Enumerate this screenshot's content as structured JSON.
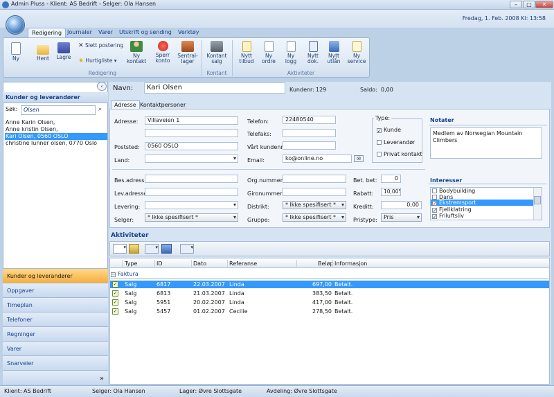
{
  "window": {
    "title": "Admin Pluss  -  Klient: AS Bedrift  -  Selger: Ola Hansen",
    "min": "–",
    "max": "□",
    "close": "✕"
  },
  "datebar": "Fredag, 1. Feb. 2008   Kl: 13:58",
  "tabs": [
    "Redigering",
    "Journaler",
    "Varer",
    "Utskrift og sending",
    "Verktøy"
  ],
  "ribbon": {
    "groups": {
      "redigering": "Redigering",
      "kontant": "Kontant",
      "aktiviteter": "Aktiviteter"
    },
    "buttons": {
      "ny": "Ny",
      "hent": "Hent",
      "lagre": "Lagre",
      "slett": "Slett postering",
      "hurtigliste": "Hurtigliste",
      "ny_kontakt_1": "Ny",
      "ny_kontakt_2": "kontakt",
      "sperr_1": "Sperr",
      "sperr_2": "konto",
      "sentral_1": "Sentral-",
      "sentral_2": "lager",
      "kontant_1": "Kontant",
      "kontant_2": "salg",
      "tilbud_1": "Nytt",
      "tilbud_2": "tilbud",
      "ordre_1": "Ny",
      "ordre_2": "ordre",
      "logg_1": "Ny",
      "logg_2": "logg",
      "dok_1": "Nytt",
      "dok_2": "dok.",
      "utlan_1": "Nytt",
      "utlan_2": "utlån",
      "service_1": "Ny",
      "service_2": "service"
    }
  },
  "left": {
    "title": "Kunder og leverandører",
    "search_label": "Søk:",
    "search_value": "Olsen",
    "items": [
      "Anne Karin Olsen,",
      "Anne kristin Olsen,",
      "Kari Olsen, 0560 OSLO",
      "christine lunner olsen, 0770 Oslo"
    ],
    "nav": [
      "Kunder og leverandører",
      "Oppgaver",
      "Timeplan",
      "Telefoner",
      "Regninger",
      "Varer",
      "Snarveier"
    ],
    "more": "»"
  },
  "header": {
    "name_label": "Navn:",
    "name_value": "Kari Olsen",
    "kundenr_label": "Kundenr:",
    "kundenr_value": "129",
    "saldo_label": "Saldo:",
    "saldo_value": "0,00"
  },
  "subtabs": [
    "Adresse",
    "Kontaktpersoner"
  ],
  "form": {
    "adresse_label": "Adresse:",
    "adresse_value": "Villaveien 1",
    "poststed_label": "Poststed:",
    "poststed_value": "0560 OSLO",
    "land_label": "Land:",
    "telefon_label": "Telefon:",
    "telefon_value": "22480540",
    "telefaks_label": "Telefaks:",
    "vart_label": "Vårt kundenr:",
    "email_label": "Email:",
    "email_value": "ko@online.no",
    "bes_label": "Bes.adresse:",
    "lev_label": "Lev.adresse:",
    "levering_label": "Levering:",
    "selger_label": "Selger:",
    "selger_value": "* Ikke spesifisert *",
    "org_label": "Org.nummer:",
    "giro_label": "Gironummer:",
    "distrikt_label": "Distrikt:",
    "distrikt_value": "* Ikke spesifisert *",
    "gruppe_label": "Gruppe:",
    "gruppe_value": "* Ikke spesifisert *",
    "betbet_label": "Bet. bet:",
    "betbet_value": "0",
    "rabatt_label": "Rabatt:",
    "rabatt_value": "10,00%",
    "kreditt_label": "Kreditt:",
    "kreditt_value": "0,00",
    "pristype_label": "Pristype:",
    "pristype_value": "Pris"
  },
  "type": {
    "title": "Type:",
    "kunde": "Kunde",
    "leverandor": "Leverandør",
    "privat": "Privat kontakt",
    "check": "✓"
  },
  "notater": {
    "title": "Notater",
    "text": "Medlem av Norwegian Mountain Climbers"
  },
  "interesser": {
    "title": "Interesser",
    "items": [
      "Bodybuilding",
      "Dans",
      "Ekstremsport",
      "Fjellklatring",
      "Friluftsliv"
    ]
  },
  "aktiviteter": {
    "title": "Aktiviteter",
    "columns": [
      "Type",
      "ID",
      "Dato",
      "Referanse",
      "Beløp",
      "Informasjon"
    ],
    "group": "Faktura",
    "rows": [
      {
        "type": "Salg",
        "id": "6817",
        "dato": "22.03.2007",
        "ref": "Linda",
        "belop": "697,00",
        "info": "Betalt."
      },
      {
        "type": "Salg",
        "id": "6813",
        "dato": "21.03.2007",
        "ref": "Linda",
        "belop": "383,50",
        "info": "Betalt."
      },
      {
        "type": "Salg",
        "id": "5951",
        "dato": "20.02.2007",
        "ref": "Linda",
        "belop": "417,00",
        "info": "Betalt."
      },
      {
        "type": "Salg",
        "id": "5457",
        "dato": "01.02.2007",
        "ref": "Cecilie",
        "belop": "278,50",
        "info": "Betalt."
      }
    ]
  },
  "status": {
    "klient": "Klient: AS Bedrift",
    "selger": "Selger: Ola Hansen",
    "lager": "Lager: Øvre Slottsgate",
    "avdeling": "Avdeling: Øvre Slottsgate"
  }
}
